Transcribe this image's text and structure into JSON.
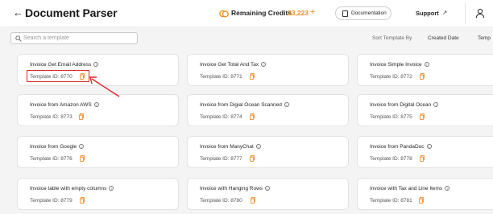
{
  "header": {
    "back_icon": "arrow-left-icon",
    "title": "Document Parser",
    "credits_label": "Remaining Credits",
    "credits_value": "23,223",
    "credits_plus": "+",
    "documentation_label": "Documentation",
    "support_label": "Support",
    "support_icon": "arrow-up-right-icon",
    "user_icon": "user-icon"
  },
  "toolbar": {
    "search_placeholder": "Search a template",
    "sort_label": "Sort Template By",
    "sort_options": [
      "Created Date",
      "Temp"
    ]
  },
  "templates": [
    {
      "name": "Invoice Get Email Address",
      "id": "Template ID: 8770"
    },
    {
      "name": "Invoice Get Total And Tax",
      "id": "Template ID: 8771"
    },
    {
      "name": "Invoice Simple Invoice",
      "id": "Template ID: 8772"
    },
    {
      "name": "Invoice from Amazon AWS",
      "id": "Template ID: 8773"
    },
    {
      "name": "Invoice from Digial Ocean Scanned",
      "id": "Template ID: 8774"
    },
    {
      "name": "Invoice from Digital Ocean",
      "id": "Template ID: 8775"
    },
    {
      "name": "Invoice from Google",
      "id": "Template ID: 8776"
    },
    {
      "name": "Invoice from ManyChat",
      "id": "Template ID: 8777"
    },
    {
      "name": "Invoice from PandaDoc",
      "id": "Template ID: 8778"
    },
    {
      "name": "Invoice table with empty columns",
      "id": "Template ID: 8779"
    },
    {
      "name": "Invoice with Hanging Rows",
      "id": "Template ID: 8780"
    },
    {
      "name": "Invoice with Tax and Line Items",
      "id": "Template ID: 8781"
    }
  ],
  "colors": {
    "accent": "#f08a24",
    "annotation": "#e02424",
    "background": "#f4f4f5",
    "card": "#ffffff"
  }
}
